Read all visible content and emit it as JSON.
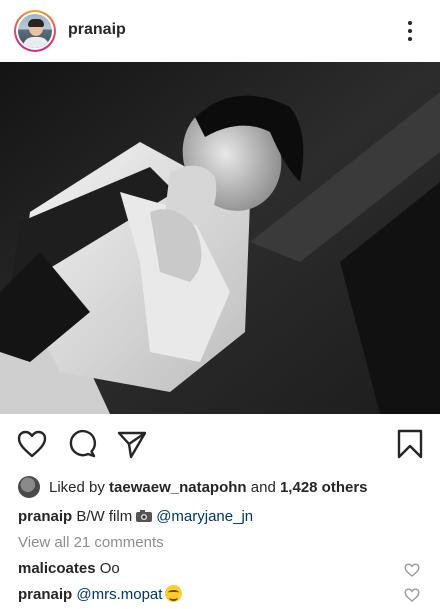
{
  "post": {
    "username": "pranaip",
    "icons": {
      "more": "more-vertical-icon",
      "like": "heart-outline-icon",
      "comment": "comment-icon",
      "share": "send-icon",
      "save": "bookmark-icon"
    }
  },
  "likes": {
    "prefix": "Liked by",
    "user": "taewaew_natapohn",
    "and": "and",
    "count": "1,428 others"
  },
  "caption": {
    "username": "pranaip",
    "text": "B/W film",
    "icon": "camera-icon",
    "mention": "@maryjane_jn"
  },
  "view_all_comments": "View all 21 comments",
  "comments": [
    {
      "username": "malicoates",
      "text": "Oo"
    },
    {
      "username": "pranaip",
      "text": "@mrs.mopat",
      "emoji": "grinning-face-emoji"
    }
  ],
  "colors": {
    "accent_link": "#003569",
    "muted": "#8e8e8e",
    "text": "#262626"
  }
}
